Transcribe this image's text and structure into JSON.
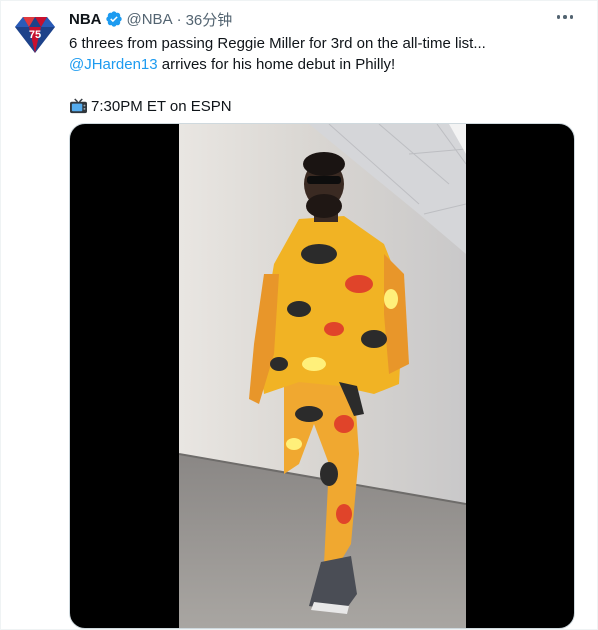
{
  "tweet": {
    "author_name": "NBA",
    "handle": "@NBA",
    "separator": "·",
    "time": "36分钟",
    "text_line1": "6 threes from passing Reggie Miller for 3rd on the all-time list...",
    "mention": "@JHarden13",
    "text_line2_rest": " arrives for his home debut in Philly!",
    "text_line3": "7:30PM ET on ESPN"
  },
  "icons": {
    "avatar": "nba-75-logo-icon",
    "verified": "verified-badge-icon",
    "more": "more-options-icon",
    "tv": "television-emoji-icon"
  },
  "colors": {
    "link": "#1d9bf0",
    "secondary_text": "#536471",
    "verified": "#1d9bf0"
  }
}
